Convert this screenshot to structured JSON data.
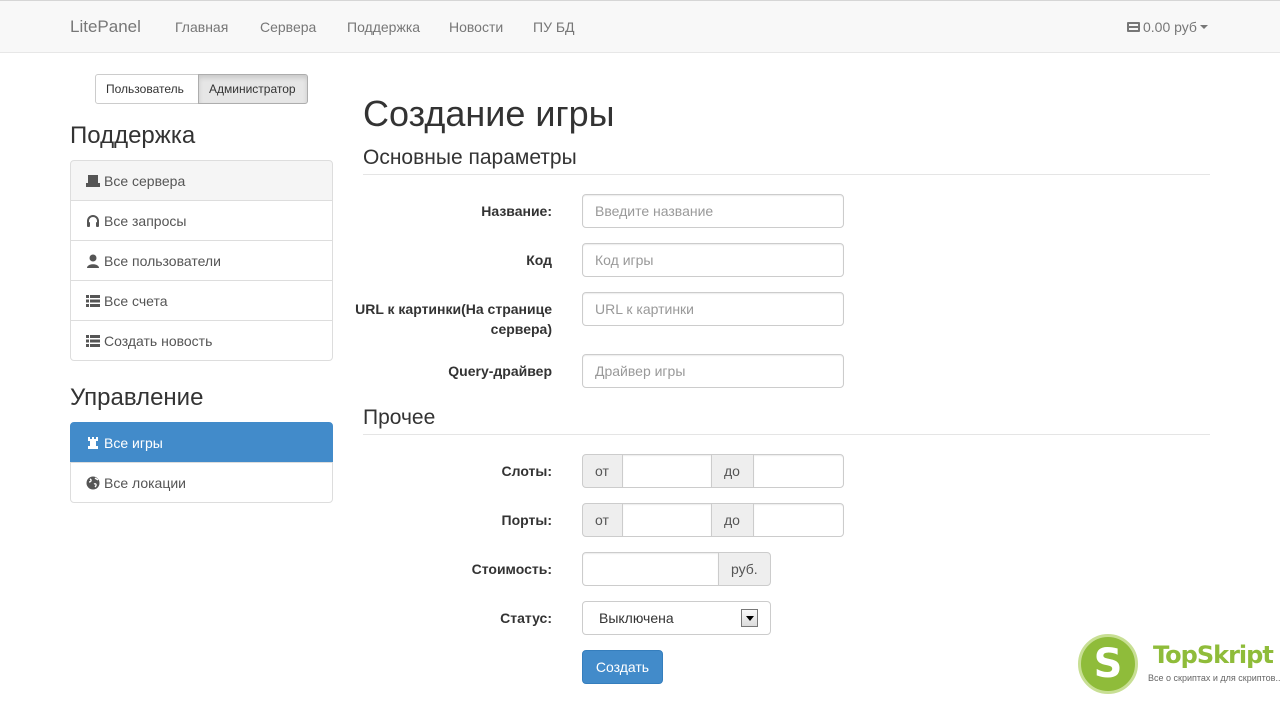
{
  "navbar": {
    "brand": "LitePanel",
    "links": [
      "Главная",
      "Сервера",
      "Поддержка",
      "Новости",
      "ПУ БД"
    ],
    "balance": "0.00 руб"
  },
  "roles": {
    "user": "Пользователь",
    "admin": "Администратор",
    "selected": "Администратор"
  },
  "sidebar": {
    "support_heading": "Поддержка",
    "support_items": [
      {
        "label": "Все сервера",
        "icon": "hdd-icon"
      },
      {
        "label": "Все запросы",
        "icon": "headphones-icon"
      },
      {
        "label": "Все пользователи",
        "icon": "user-icon"
      },
      {
        "label": "Все счета",
        "icon": "list-icon"
      },
      {
        "label": "Создать новость",
        "icon": "list-icon"
      }
    ],
    "manage_heading": "Управление",
    "manage_items": [
      {
        "label": "Все игры",
        "icon": "tower-icon",
        "active": true
      },
      {
        "label": "Все локации",
        "icon": "globe-icon"
      }
    ]
  },
  "main": {
    "title": "Создание игры",
    "section_basic": "Основные параметры",
    "fields": {
      "name": {
        "label": "Название:",
        "placeholder": "Введите название"
      },
      "code": {
        "label": "Код",
        "placeholder": "Код игры"
      },
      "image_url": {
        "label": "URL к картинки(На странице сервера)",
        "placeholder": "URL к картинки"
      },
      "query": {
        "label": "Query-драйвер",
        "placeholder": "Драйвер игры"
      }
    },
    "section_other": "Прочее",
    "slots": {
      "label": "Слоты:",
      "from": "от",
      "to": "до"
    },
    "ports": {
      "label": "Порты:",
      "from": "от",
      "to": "до"
    },
    "price": {
      "label": "Стоимость:",
      "currency": "руб."
    },
    "status": {
      "label": "Статус:",
      "value": "Выключена"
    },
    "submit": "Создать"
  },
  "watermark": {
    "name": "TopSkript",
    "tagline": "Все о скриптах и для скриптов...",
    "logo_letter": "S"
  },
  "colors": {
    "primary": "#428bca",
    "navbar_bg": "#f8f8f8",
    "watermark_green": "#8fbc3a"
  }
}
